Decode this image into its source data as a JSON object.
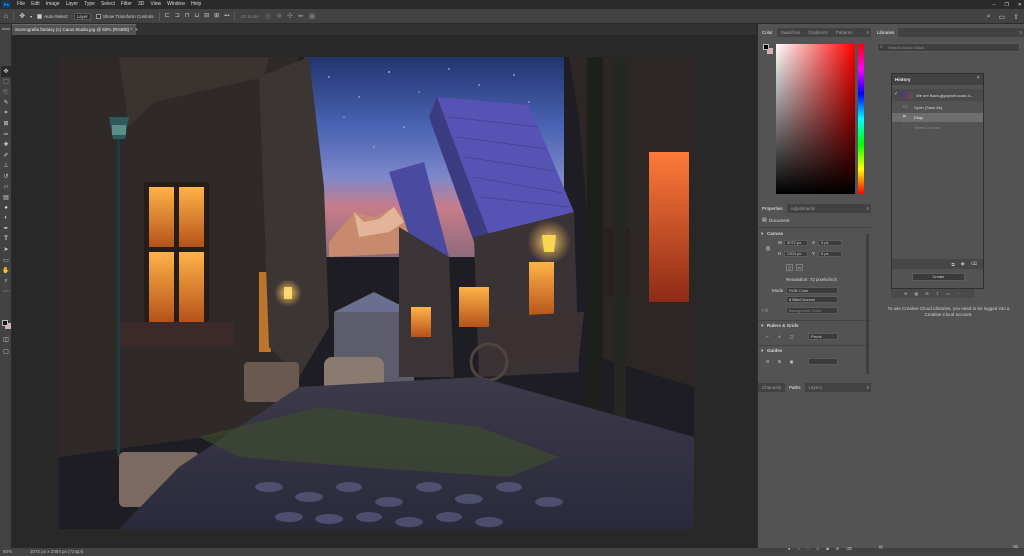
{
  "app": {
    "logo": "Ps",
    "menu": [
      "File",
      "Edit",
      "Image",
      "Layer",
      "Type",
      "Select",
      "Filter",
      "3D",
      "View",
      "Window",
      "Help"
    ],
    "window_controls": [
      "–",
      "❐",
      "✕"
    ]
  },
  "options_bar": {
    "auto_select_label": "Auto-Select:",
    "auto_select_checked": true,
    "auto_select_target": "Layer",
    "show_transform_label": "Show Transform Controls",
    "show_transform_checked": false,
    "mode_3d_label": "3D Mode:"
  },
  "document": {
    "tab_title": "Scenografia fantasy (c) Cauvi Studio.jpg @ 50% (RGB/8) *",
    "tab_close": "×"
  },
  "status": {
    "zoom": "50%",
    "info": "3072 px x 2304 px (72 ppi)"
  },
  "color_panel": {
    "tabs": [
      "Color",
      "Swatches",
      "Gradients",
      "Patterns"
    ],
    "active_tab": "Color",
    "fg_color": "#000000",
    "bg_color": "#e8a6b8",
    "hue_color": "#ff0000"
  },
  "properties_panel": {
    "tabs": [
      "Properties",
      "Adjustments"
    ],
    "active_tab": "Properties",
    "document_label": "Document",
    "canvas_header": "Canvas",
    "w_label": "W",
    "w_value": "3072 px",
    "x_label": "X",
    "x_value": "0 px",
    "h_label": "H",
    "h_value": "2304 px",
    "y_label": "Y",
    "y_value": "0 px",
    "resolution": "Resolution: 72 pixels/inch",
    "mode_label": "Mode",
    "mode_value": "RGB Color",
    "depth_value": "8 Bits/Channel",
    "fill_label": "Fill",
    "fill_value": "Background Color",
    "rulers_header": "Rulers & Grids",
    "rulers_unit": "Pixels",
    "guides_header": "Guides"
  },
  "bottom_panel": {
    "tabs": [
      "Channels",
      "Paths",
      "Layers"
    ],
    "active_tab": "Paths"
  },
  "libraries_panel": {
    "title": "Libraries",
    "search_placeholder": "Search Adobe Stock",
    "message": "To use Creative Cloud Libraries, you need to be logged into a Creative Cloud account."
  },
  "history_panel": {
    "title": "History",
    "snapshot": "We are Back-gigapixel-scale-4...",
    "items": [
      "Open (Save As)",
      "Crop",
      "Select Canvas"
    ],
    "active_index": 1,
    "create_button": "Create"
  }
}
